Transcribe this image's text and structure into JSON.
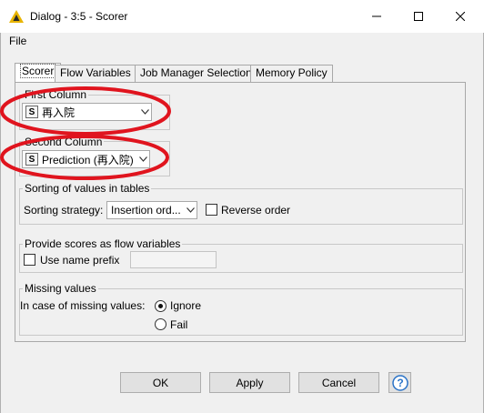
{
  "window": {
    "title": "Dialog - 3:5 - Scorer",
    "icon": "warning-triangle-icon",
    "controls": [
      "minimize-icon",
      "maximize-icon",
      "close-icon"
    ]
  },
  "menu": {
    "file": "File"
  },
  "tabs": [
    {
      "label": "Scorer",
      "active": true
    },
    {
      "label": "Flow Variables",
      "active": false
    },
    {
      "label": "Job Manager Selection",
      "active": false
    },
    {
      "label": "Memory Policy",
      "active": false
    }
  ],
  "first_column": {
    "title": "First Column",
    "type_badge": "S",
    "value": "再入院"
  },
  "second_column": {
    "title": "Second Column",
    "type_badge": "S",
    "value": "Prediction (再入院)"
  },
  "sorting": {
    "title": "Sorting of values in tables",
    "strategy_label": "Sorting strategy:",
    "strategy_value": "Insertion ord...",
    "reverse_label": "Reverse order",
    "reverse_checked": false
  },
  "scores": {
    "title": "Provide scores as flow variables",
    "prefix_label": "Use name prefix",
    "prefix_checked": false,
    "prefix_value": ""
  },
  "missing": {
    "title": "Missing values",
    "label": "In case of missing values:",
    "options": [
      {
        "label": "Ignore",
        "checked": true
      },
      {
        "label": "Fail",
        "checked": false
      }
    ]
  },
  "buttons": {
    "ok": "OK",
    "apply": "Apply",
    "cancel": "Cancel",
    "help_icon": "help-icon"
  },
  "colors": {
    "annotation": "#e0141e",
    "title_icon": "#e8b400",
    "help_icon": "#2a73c8"
  }
}
